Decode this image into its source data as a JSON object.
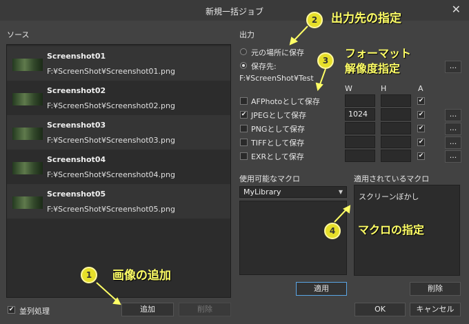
{
  "window": {
    "title": "新規一括ジョブ",
    "close_glyph": "✕"
  },
  "source": {
    "label": "ソース",
    "items": [
      {
        "name": "Screenshot01",
        "path": "F:¥ScreenShot¥Screenshot01.png"
      },
      {
        "name": "Screenshot02",
        "path": "F:¥ScreenShot¥Screenshot02.png"
      },
      {
        "name": "Screenshot03",
        "path": "F:¥ScreenShot¥Screenshot03.png"
      },
      {
        "name": "Screenshot04",
        "path": "F:¥ScreenShot¥Screenshot04.png"
      },
      {
        "name": "Screenshot05",
        "path": "F:¥ScreenShot¥Screenshot05.png"
      }
    ]
  },
  "output": {
    "label": "出力",
    "radio_original": "元の場所に保存",
    "radio_dest": "保存先:",
    "dest_path": "F:¥ScreenShot¥Test",
    "dots": "...",
    "col_w": "W",
    "col_h": "H",
    "col_a": "A",
    "formats": [
      {
        "label": "AFPhotoとして保存",
        "checked": false,
        "w": "",
        "h": "",
        "a": true
      },
      {
        "label": "JPEGとして保存",
        "checked": true,
        "w": "1024",
        "h": "",
        "a": true
      },
      {
        "label": "PNGとして保存",
        "checked": false,
        "w": "",
        "h": "",
        "a": true
      },
      {
        "label": "TIFFとして保存",
        "checked": false,
        "w": "",
        "h": "",
        "a": true
      },
      {
        "label": "EXRとして保存",
        "checked": false,
        "w": "",
        "h": "",
        "a": true
      }
    ]
  },
  "macros": {
    "available_label": "使用可能なマクロ",
    "library": "MyLibrary",
    "applied_label": "適用されているマクロ",
    "applied_items": [
      "スクリーンぼかし"
    ],
    "apply_button": "適用",
    "delete_button": "削除"
  },
  "footer": {
    "parallel_label": "並列処理",
    "add_button": "追加",
    "remove_button": "削除",
    "ok_button": "OK",
    "cancel_button": "キャンセル"
  },
  "annotations": {
    "n1": "1",
    "t1": "画像の追加",
    "n2": "2",
    "t2": "出力先の指定",
    "n3": "3",
    "t3a": "フォーマット",
    "t3b": "解像度指定",
    "n4": "4",
    "t4": "マクロの指定"
  },
  "colors": {
    "annotation": "#ffff66",
    "badge": "#e6df2a",
    "dialog_bg": "#424242"
  }
}
